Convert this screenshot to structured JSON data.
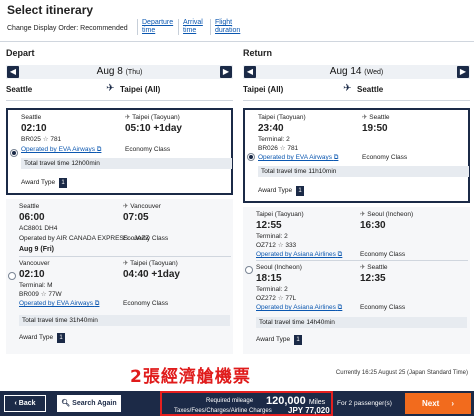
{
  "header": {
    "title": "Select itinerary",
    "order_label": "Change Display Order:",
    "order_current": "Recommended",
    "order_options": [
      {
        "line1": "Departure",
        "line2": "time"
      },
      {
        "line1": "Arrival",
        "line2": "time"
      },
      {
        "line1": "Flight",
        "line2": "duration"
      }
    ]
  },
  "depart": {
    "heading": "Depart",
    "date": "Aug 8",
    "weekday": "(Thu)",
    "from": "Seattle",
    "to": "Taipei (All)",
    "options": [
      {
        "selected": true,
        "dep_city": "Seattle",
        "dep_time": "02:10",
        "arr_city": "Taipei (Taoyuan)",
        "arr_time": "05:10 +1day",
        "flight_no": "BR025",
        "aircraft": "781",
        "operator": "Operated by EVA Airways",
        "cabin": "Economy Class",
        "total": "Total travel time 12h00min",
        "award": "Award Type",
        "award_code": "1"
      },
      {
        "selected": false,
        "seg1": {
          "dep_city": "Seattle",
          "dep_time": "06:00",
          "arr_city": "Vancouver",
          "arr_time": "07:05",
          "flight_no": "AC8801",
          "aircraft": "DH4",
          "operator": "Operated by AIR CANADA EXPRESS - JAZZ",
          "cabin": "Economy Class"
        },
        "day_label": "Aug 9 (Fri)",
        "seg2": {
          "dep_city": "Vancouver",
          "dep_time": "02:10",
          "terminal": "Terminal: M",
          "arr_city": "Taipei (Taoyuan)",
          "arr_time": "04:40 +1day",
          "flight_no": "BR009",
          "aircraft": "77W",
          "operator": "Operated by EVA Airways",
          "cabin": "Economy Class"
        },
        "total": "Total travel time 31h40min",
        "award": "Award Type",
        "award_code": "1"
      }
    ]
  },
  "return": {
    "heading": "Return",
    "date": "Aug 14",
    "weekday": "(Wed)",
    "from": "Taipei (All)",
    "to": "Seattle",
    "options": [
      {
        "selected": true,
        "dep_city": "Taipei (Taoyuan)",
        "dep_time": "23:40",
        "terminal": "Terminal: 2",
        "arr_city": "Seattle",
        "arr_time": "19:50",
        "flight_no": "BR026",
        "aircraft": "781",
        "operator": "Operated by EVA Airways",
        "cabin": "Economy Class",
        "total": "Total travel time 11h10min",
        "award": "Award Type",
        "award_code": "1"
      },
      {
        "selected": false,
        "seg1": {
          "dep_city": "Taipei (Taoyuan)",
          "dep_time": "12:55",
          "terminal": "Terminal: 2",
          "arr_city": "Seoul (Incheon)",
          "arr_time": "16:30",
          "flight_no": "OZ712",
          "aircraft": "333",
          "operator": "Operated by Asiana Airlines",
          "cabin": "Economy Class"
        },
        "seg2": {
          "dep_city": "Seoul (Incheon)",
          "dep_time": "18:15",
          "terminal": "Terminal: 2",
          "arr_city": "Seattle",
          "arr_time": "12:35",
          "flight_no": "OZ272",
          "aircraft": "77L",
          "operator": "Operated by Asiana Airlines",
          "cabin": "Economy Class"
        },
        "total": "Total travel time 14h40min",
        "award": "Award Type",
        "award_code": "1"
      }
    ]
  },
  "status_time": "Currently 16:25 August 25 (Japan Standard Time)",
  "promo_text": "2張經濟艙機票",
  "footer": {
    "back": "Back",
    "search_again": "Search Again",
    "mileage_label": "Required mileage",
    "mileage_value": "120,000",
    "mileage_unit": "Miles",
    "taxes_label": "Taxes/Fees/Charges/Airline Charges",
    "taxes_value": "JPY 77,020",
    "passengers": "For 2 passenger(s)",
    "next": "Next"
  },
  "colors": {
    "navy": "#1c2a47",
    "link": "#0b57b0",
    "next": "#f26b1d",
    "highlight": "#e5201f",
    "promo": "#e01b1b"
  }
}
